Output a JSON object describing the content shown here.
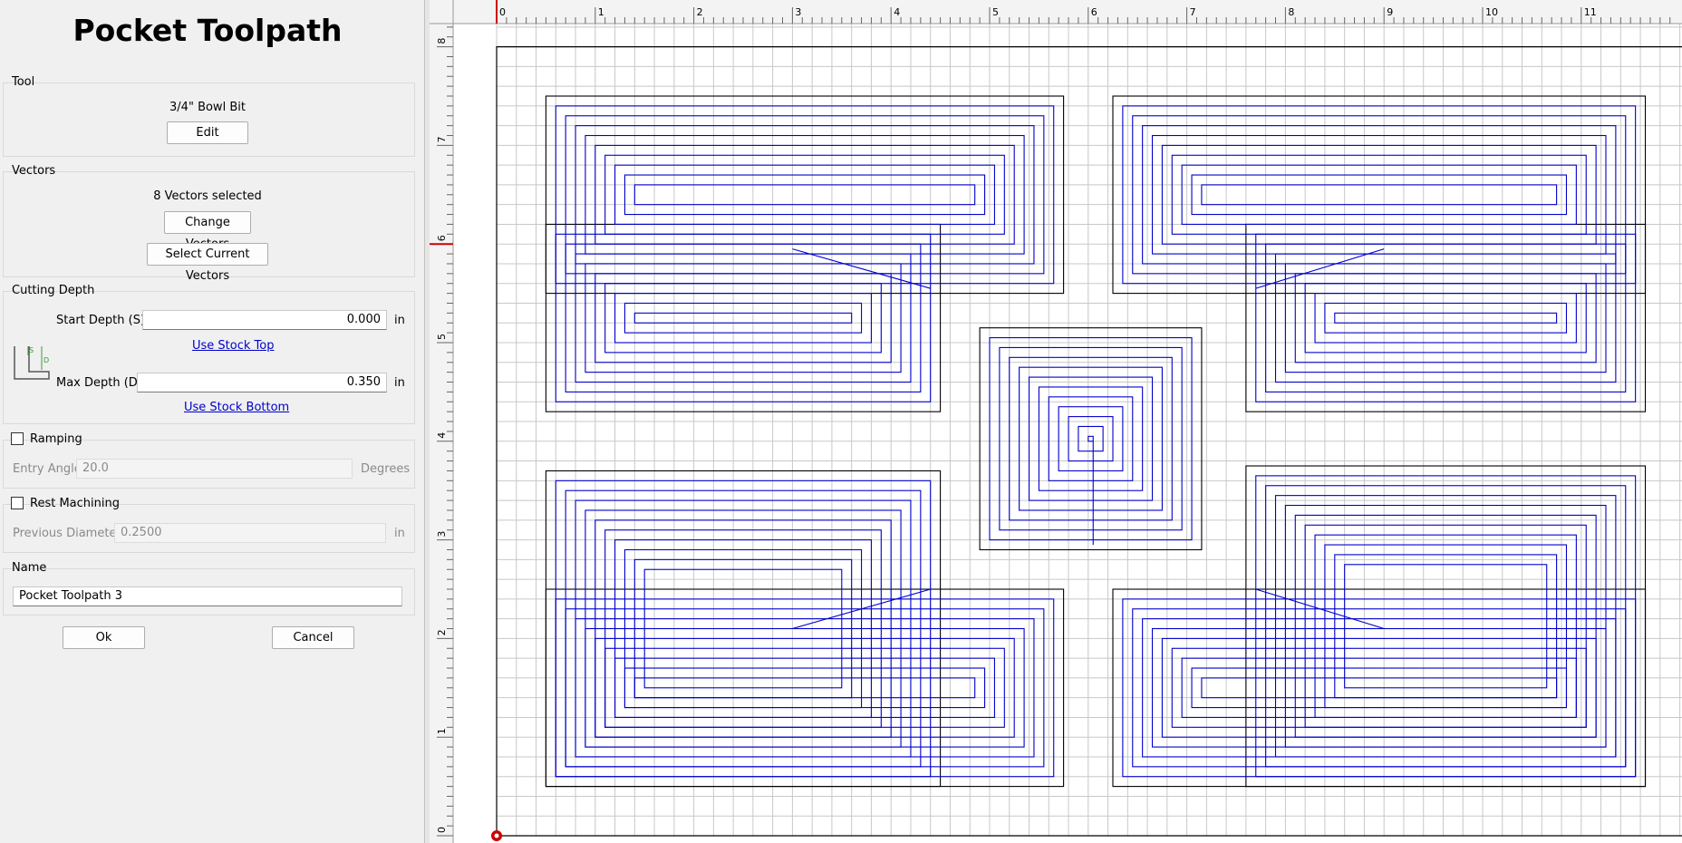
{
  "panel": {
    "title": "Pocket Toolpath",
    "tool": {
      "label": "Tool",
      "name": "3/4\" Bowl Bit",
      "edit_label": "Edit"
    },
    "vectors": {
      "label": "Vectors",
      "status": "8 Vectors selected",
      "change_label": "Change Vectors",
      "select_label": "Select Current Vectors"
    },
    "depth": {
      "label": "Cutting Depth",
      "start_label": "Start Depth (S)",
      "start_value": "0.000",
      "start_unit": "in",
      "use_top": "Use Stock Top",
      "max_label": "Max Depth (D)",
      "max_value": "0.350",
      "max_unit": "in",
      "use_bottom": "Use Stock Bottom",
      "diagram_s": "S",
      "diagram_d": "D"
    },
    "ramping": {
      "label": "Ramping",
      "checked": false,
      "angle_label": "Entry Angle",
      "angle_value": "20.0",
      "angle_unit": "Degrees"
    },
    "rest": {
      "label": "Rest Machining",
      "checked": false,
      "diam_label": "Previous Diameter",
      "diam_value": "0.2500",
      "diam_unit": "in"
    },
    "name": {
      "label": "Name",
      "value": "Pocket Toolpath 3"
    },
    "ok_label": "Ok",
    "cancel_label": "Cancel"
  },
  "canvas": {
    "x_ticks": [
      "0",
      "1",
      "2",
      "3",
      "4",
      "5",
      "6",
      "7",
      "8",
      "9",
      "10",
      "11"
    ],
    "y_ticks": [
      "0",
      "1",
      "2",
      "3",
      "4",
      "5",
      "6",
      "7",
      "8"
    ],
    "grid_step": 0.2,
    "colors": {
      "outline": "#000000",
      "toolpath": "#0000cc",
      "grid": "#c8c8c8",
      "origin": "#cc0000"
    }
  }
}
